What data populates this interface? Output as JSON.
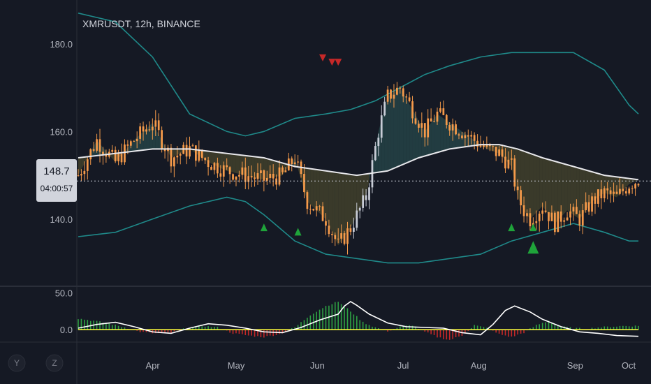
{
  "title": "XMRUSDT, 12h, BINANCE",
  "price_label": "148.7",
  "countdown": "04:00:57",
  "side_buttons": [
    "Y",
    "Z"
  ],
  "colors": {
    "background": "#151924",
    "candle": "#f59a4a",
    "candle_alt": "#c8ccd6",
    "band": "#1f8a8a",
    "ma": "#e8e8ec",
    "cloud_bull": "#2d5a5a",
    "cloud_bear": "#5a5530",
    "buy_signal": "#1fa33a",
    "sell_signal": "#c62828",
    "osc_line": "#ffffff",
    "osc_zero": "#f2f23a",
    "osc_hist_pos": "#2ea043",
    "osc_hist_neg": "#c62828"
  },
  "chart_data": [
    {
      "type": "candlestick",
      "title": "XMRUSDT, 12h, BINANCE",
      "x_ticks": [
        "Apr",
        "May",
        "Jun",
        "Jul",
        "Aug",
        "Sep",
        "Oct"
      ],
      "y_ticks": [
        180.0,
        160.0,
        140.0
      ],
      "ylim": [
        125,
        190
      ],
      "last_price": 148.7,
      "close_path": [
        [
          0,
          150
        ],
        [
          6,
          158
        ],
        [
          12,
          153
        ],
        [
          18,
          158
        ],
        [
          24,
          162
        ],
        [
          30,
          154
        ],
        [
          36,
          156
        ],
        [
          42,
          153
        ],
        [
          48,
          151
        ],
        [
          54,
          150
        ],
        [
          60,
          149
        ],
        [
          66,
          150
        ],
        [
          70,
          154
        ],
        [
          74,
          144
        ],
        [
          80,
          140
        ],
        [
          84,
          134
        ],
        [
          88,
          138
        ],
        [
          93,
          145
        ],
        [
          97,
          160
        ],
        [
          100,
          168
        ],
        [
          104,
          170
        ],
        [
          108,
          165
        ],
        [
          112,
          160
        ],
        [
          116,
          164
        ],
        [
          120,
          162
        ],
        [
          124,
          160
        ],
        [
          128,
          158
        ],
        [
          132,
          156
        ],
        [
          136,
          155
        ],
        [
          140,
          152
        ],
        [
          142,
          145
        ],
        [
          144,
          142
        ],
        [
          146,
          140
        ],
        [
          150,
          143
        ],
        [
          154,
          139
        ],
        [
          158,
          142
        ],
        [
          162,
          140
        ],
        [
          166,
          144
        ],
        [
          170,
          146
        ],
        [
          174,
          145
        ],
        [
          178,
          148
        ],
        [
          181,
          149
        ]
      ],
      "upper_band": [
        [
          0,
          187
        ],
        [
          12,
          185
        ],
        [
          24,
          177
        ],
        [
          36,
          164
        ],
        [
          48,
          160
        ],
        [
          54,
          159
        ],
        [
          60,
          160
        ],
        [
          70,
          163
        ],
        [
          80,
          164
        ],
        [
          88,
          165
        ],
        [
          96,
          167
        ],
        [
          104,
          170
        ],
        [
          112,
          173
        ],
        [
          120,
          175
        ],
        [
          130,
          177
        ],
        [
          140,
          178
        ],
        [
          150,
          178
        ],
        [
          160,
          178
        ],
        [
          170,
          174
        ],
        [
          178,
          166
        ],
        [
          181,
          164
        ]
      ],
      "lower_band": [
        [
          0,
          136
        ],
        [
          12,
          137
        ],
        [
          24,
          140
        ],
        [
          36,
          143
        ],
        [
          48,
          145
        ],
        [
          54,
          144
        ],
        [
          60,
          141
        ],
        [
          70,
          135
        ],
        [
          80,
          132
        ],
        [
          90,
          131
        ],
        [
          100,
          130
        ],
        [
          110,
          130
        ],
        [
          120,
          131
        ],
        [
          130,
          132
        ],
        [
          140,
          135
        ],
        [
          150,
          137
        ],
        [
          160,
          139
        ],
        [
          170,
          137
        ],
        [
          178,
          135
        ],
        [
          181,
          135
        ]
      ],
      "moving_average": [
        [
          0,
          154
        ],
        [
          12,
          155
        ],
        [
          24,
          156
        ],
        [
          36,
          156
        ],
        [
          48,
          155
        ],
        [
          60,
          154
        ],
        [
          70,
          152
        ],
        [
          80,
          151
        ],
        [
          90,
          150
        ],
        [
          100,
          151
        ],
        [
          110,
          154
        ],
        [
          120,
          156
        ],
        [
          130,
          157
        ],
        [
          136,
          157
        ],
        [
          142,
          156
        ],
        [
          150,
          154
        ],
        [
          160,
          152
        ],
        [
          170,
          150
        ],
        [
          181,
          149
        ]
      ],
      "buy_signals": [
        {
          "i": 60,
          "price": 139
        },
        {
          "i": 71,
          "price": 138
        },
        {
          "i": 140,
          "price": 139
        },
        {
          "i": 147,
          "price": 139
        },
        {
          "i": 147,
          "price": 135
        }
      ],
      "sell_signals": [
        {
          "i": 79,
          "price": 176
        },
        {
          "i": 82,
          "price": 175
        },
        {
          "i": 84,
          "price": 175
        }
      ]
    },
    {
      "type": "line",
      "name": "oscillator",
      "y_ticks": [
        50.0,
        0.0
      ],
      "ylim": [
        -15,
        55
      ],
      "line": [
        [
          0,
          2
        ],
        [
          6,
          7
        ],
        [
          12,
          10
        ],
        [
          18,
          4
        ],
        [
          24,
          -3
        ],
        [
          30,
          -5
        ],
        [
          36,
          2
        ],
        [
          42,
          8
        ],
        [
          48,
          6
        ],
        [
          54,
          2
        ],
        [
          60,
          -3
        ],
        [
          66,
          -4
        ],
        [
          72,
          3
        ],
        [
          78,
          13
        ],
        [
          84,
          21
        ],
        [
          86,
          32
        ],
        [
          88,
          38
        ],
        [
          90,
          33
        ],
        [
          94,
          21
        ],
        [
          100,
          9
        ],
        [
          106,
          4
        ],
        [
          112,
          3
        ],
        [
          118,
          2
        ],
        [
          124,
          -4
        ],
        [
          130,
          -7
        ],
        [
          134,
          7
        ],
        [
          138,
          26
        ],
        [
          141,
          32
        ],
        [
          146,
          24
        ],
        [
          150,
          14
        ],
        [
          156,
          4
        ],
        [
          162,
          -3
        ],
        [
          168,
          -5
        ],
        [
          174,
          -8
        ],
        [
          181,
          -9
        ]
      ],
      "histogram": [
        [
          0,
          15
        ],
        [
          5,
          12
        ],
        [
          10,
          8
        ],
        [
          15,
          3
        ],
        [
          20,
          -3
        ],
        [
          25,
          -5
        ],
        [
          30,
          -4
        ],
        [
          35,
          2
        ],
        [
          40,
          5
        ],
        [
          45,
          3
        ],
        [
          50,
          -5
        ],
        [
          55,
          -8
        ],
        [
          60,
          -10
        ],
        [
          65,
          -6
        ],
        [
          70,
          3
        ],
        [
          75,
          20
        ],
        [
          80,
          32
        ],
        [
          84,
          38
        ],
        [
          88,
          25
        ],
        [
          92,
          10
        ],
        [
          96,
          3
        ],
        [
          100,
          -2
        ],
        [
          104,
          4
        ],
        [
          108,
          6
        ],
        [
          112,
          -3
        ],
        [
          116,
          -10
        ],
        [
          120,
          -14
        ],
        [
          124,
          -8
        ],
        [
          128,
          6
        ],
        [
          132,
          2
        ],
        [
          136,
          -6
        ],
        [
          140,
          -10
        ],
        [
          144,
          -4
        ],
        [
          148,
          6
        ],
        [
          152,
          12
        ],
        [
          156,
          4
        ],
        [
          160,
          2
        ],
        [
          164,
          1
        ],
        [
          168,
          3
        ],
        [
          172,
          4
        ],
        [
          176,
          5
        ],
        [
          181,
          5
        ]
      ]
    }
  ]
}
